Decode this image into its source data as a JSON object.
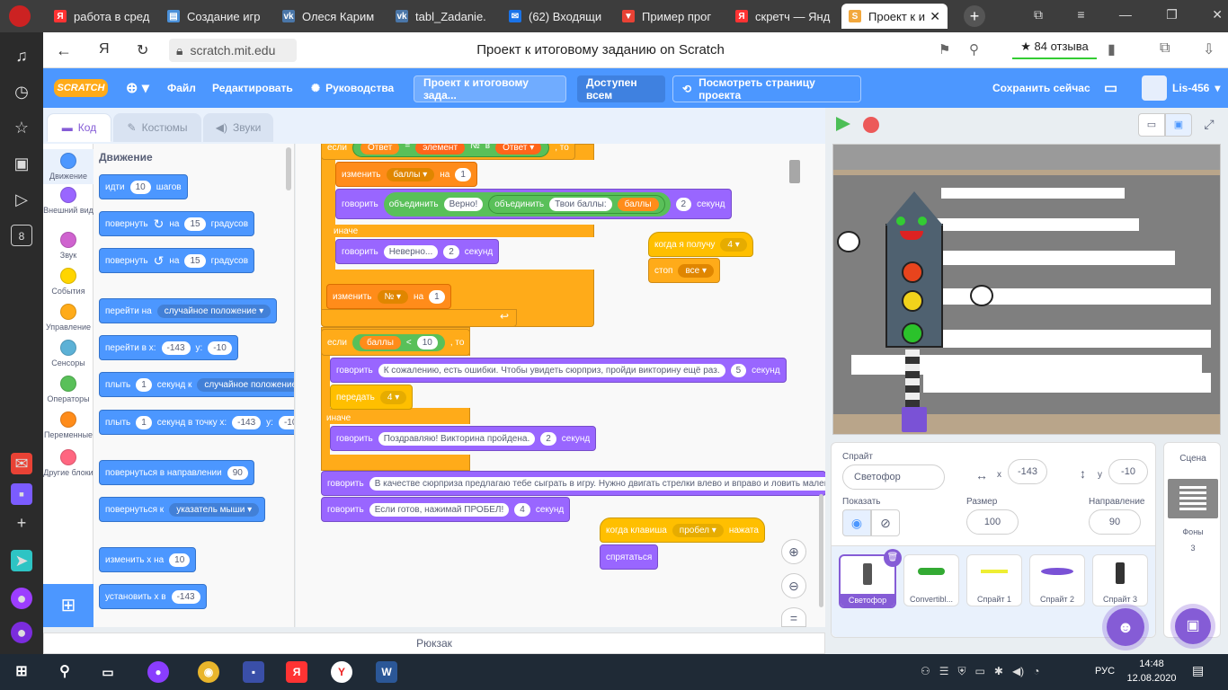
{
  "browser": {
    "tabs": [
      {
        "label": "работа в сред",
        "color": "#ff3333",
        "glyph": "Я"
      },
      {
        "label": "Создание игр",
        "color": "#4a90d9",
        "glyph": "▤"
      },
      {
        "label": "Олеся Карим",
        "color": "#4a76a8",
        "glyph": "vk"
      },
      {
        "label": "tabl_Zadanie.",
        "color": "#4a76a8",
        "glyph": "vk"
      },
      {
        "label": "(62) Входящи",
        "color": "#1a73e8",
        "glyph": "✉"
      },
      {
        "label": "Пример прог",
        "color": "#e94235",
        "glyph": "▼"
      },
      {
        "label": "скретч — Янд",
        "color": "#ff3333",
        "glyph": "Я"
      },
      {
        "label": "Проект к и",
        "color": "#f2a83d",
        "glyph": "S"
      }
    ],
    "url": "scratch.mit.edu",
    "page_title": "Проект к итоговому заданию on Scratch",
    "reviews": "★ 84 отзыва"
  },
  "menu": {
    "logo": "SCRATCH",
    "file": "Файл",
    "edit": "Редактировать",
    "tutorials": "Руководства",
    "project_title": "Проект к итоговому зада...",
    "share": "Доступен всем",
    "see_project": "Посмотреть страницу проекта",
    "save_now": "Сохранить сейчас",
    "username": "Lis-456"
  },
  "tabs": {
    "code": "Код",
    "costumes": "Костюмы",
    "sounds": "Звуки"
  },
  "categories": [
    {
      "label": "Движение",
      "color": "#4c97ff"
    },
    {
      "label": "Внешний вид",
      "color": "#9966ff"
    },
    {
      "label": "Звук",
      "color": "#cf63cf"
    },
    {
      "label": "События",
      "color": "#ffd500"
    },
    {
      "label": "Управление",
      "color": "#ffab19"
    },
    {
      "label": "Сенсоры",
      "color": "#5cb1d6"
    },
    {
      "label": "Операторы",
      "color": "#59c059"
    },
    {
      "label": "Переменные",
      "color": "#ff8c1a"
    },
    {
      "label": "Другие блоки",
      "color": "#ff6680"
    }
  ],
  "palette": {
    "heading": "Движение",
    "move": [
      "идти",
      "10",
      "шагов"
    ],
    "turn_right": [
      "повернуть",
      "↻",
      "на",
      "15",
      "градусов"
    ],
    "turn_left": [
      "повернуть",
      "↺",
      "на",
      "15",
      "градусов"
    ],
    "goto": [
      "перейти на",
      "случайное положение ▾"
    ],
    "goto_xy": [
      "перейти в x:",
      "-143",
      "y:",
      "-10"
    ],
    "glide": [
      "плыть",
      "1",
      "секунд к",
      "случайное положение"
    ],
    "glide_xy": [
      "плыть",
      "1",
      "секунд в точку x:",
      "-143",
      "y:",
      "-10"
    ],
    "point_dir": [
      "повернуться в направлении",
      "90"
    ],
    "point_to": [
      "повернуться к",
      "указатель мыши ▾"
    ],
    "change_x": [
      "изменить х на",
      "10"
    ],
    "set_x": [
      "установить х в",
      "-143"
    ]
  },
  "script": {
    "top_if": [
      "если",
      "Ответ",
      "=",
      "элемент",
      "№",
      "в",
      "Ответ ▾",
      ", то"
    ],
    "change_score": [
      "изменить",
      "баллы ▾",
      "на",
      "1"
    ],
    "say_join": [
      "говорить",
      "объединить",
      "Верно!",
      "объединить",
      "Твои баллы:",
      "баллы",
      "2",
      "секунд"
    ],
    "else1": "иначе",
    "say_wrong": [
      "говорить",
      "Неверно...",
      "2",
      "секунд"
    ],
    "change_n": [
      "изменить",
      "№ ▾",
      "на",
      "1"
    ],
    "if2": [
      "если",
      "баллы",
      "<",
      "10",
      ", то"
    ],
    "say_mistakes": [
      "говорить",
      "К сожалению, есть ошибки. Чтобы увидеть сюрприз, пройди викторину ещё раз.",
      "5",
      "секунд"
    ],
    "goto_backdrop": [
      "передать",
      "4 ▾"
    ],
    "else2": "иначе",
    "say_congrats": [
      "говорить",
      "Поздравляю! Викторина пройдена.",
      "2",
      "секунд"
    ],
    "say_surprise": [
      "говорить",
      "В качестве сюрприза предлагаю тебе сыграть в игру. Нужно двигать стрелки влево и вправо и ловить маленьки"
    ],
    "say_ready": [
      "говорить",
      "Если готов, нажимай ПРОБЕЛ!",
      "4",
      "секунд"
    ],
    "when_receive": [
      "когда я получу",
      "4 ▾"
    ],
    "stop": [
      "стоп",
      "все ▾"
    ],
    "when_key": [
      "когда клавиша",
      "пробел ▾",
      "нажата"
    ],
    "hide": "спрятаться"
  },
  "backpack": "Рюкзак",
  "sprite_info": {
    "sprite_label": "Спрайт",
    "sprite_name": "Светофор",
    "x_label": "x",
    "x": "-143",
    "y_label": "y",
    "y": "-10",
    "show_label": "Показать",
    "size_label": "Размер",
    "size": "100",
    "dir_label": "Направление",
    "direction": "90"
  },
  "sprites": [
    "Светофор",
    "Convertibl...",
    "Спрайт 1",
    "Спрайт 2",
    "Спрайт 3"
  ],
  "stage_pane": {
    "title": "Сцена",
    "backdrops_label": "Фоны",
    "backdrops_count": "3"
  },
  "taskbar": {
    "lang": "РУС",
    "time": "14:48",
    "date": "12.08.2020"
  }
}
